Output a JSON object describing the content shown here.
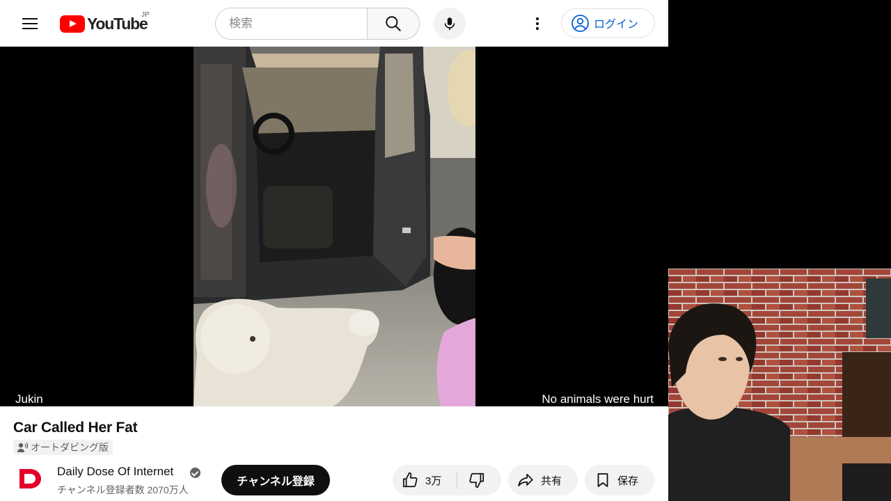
{
  "masthead": {
    "logo_text": "YouTube",
    "region": "JP",
    "search_placeholder": "検索",
    "login_label": "ログイン"
  },
  "player": {
    "overlay_left": "Jukin",
    "overlay_right": "No animals were hurt"
  },
  "video": {
    "title": "Car Called Her Fat",
    "dubbing_label": "オートダビング版"
  },
  "channel": {
    "name": "Daily Dose Of Internet",
    "subscribers": "チャンネル登録者数 2070万人",
    "subscribe_label": "チャンネル登録"
  },
  "actions": {
    "like_count": "3万",
    "share_label": "共有",
    "save_label": "保存"
  },
  "colors": {
    "brand_red": "#ff0000",
    "link_blue": "#065fd4",
    "text": "#0f0f0f",
    "secondary_text": "#606060",
    "pill_bg": "#f2f2f2"
  },
  "icons": [
    "menu-icon",
    "youtube-logo-icon",
    "search-icon",
    "microphone-icon",
    "more-vert-icon",
    "account-circle-icon",
    "dubbing-icon",
    "verified-icon",
    "thumb-up-icon",
    "thumb-down-icon",
    "share-icon",
    "bookmark-icon"
  ]
}
